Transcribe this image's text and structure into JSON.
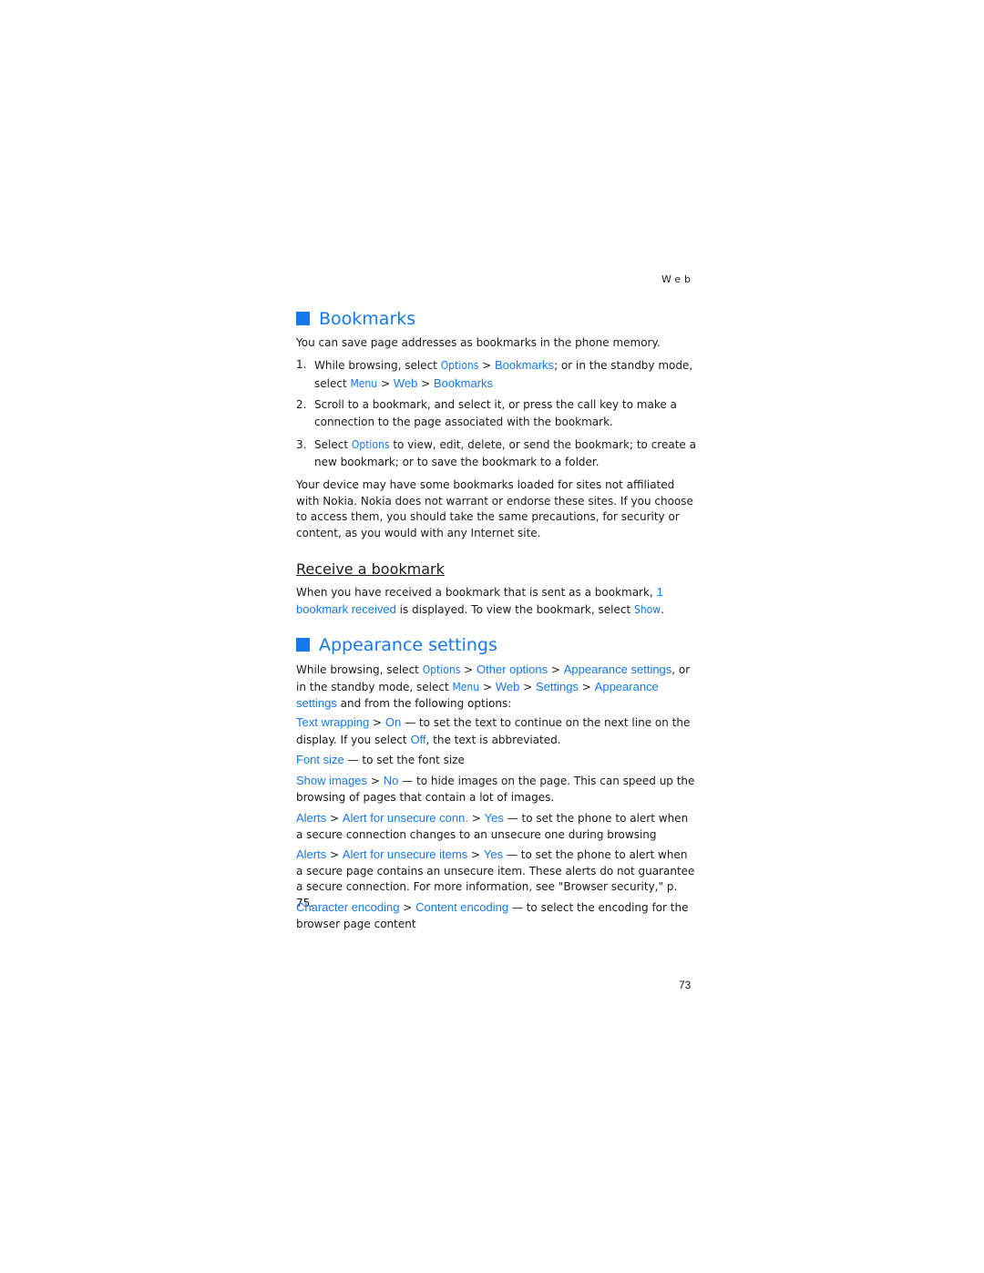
{
  "running_head": "Web",
  "page_number": "73",
  "sections": {
    "bookmarks": {
      "title": "Bookmarks",
      "intro": "You can save page addresses as bookmarks in the phone memory.",
      "steps": [
        {
          "num": "1.",
          "t1": "While browsing, select ",
          "ui1": "Options",
          "t2": " > ",
          "ui2": "Bookmarks",
          "t3": "; or in the standby mode, select ",
          "ui3": "Menu",
          "t4": " > ",
          "ui4": "Web",
          "t5": " > ",
          "ui5": "Bookmarks"
        },
        {
          "num": "2.",
          "text": "Scroll to a bookmark, and select it, or press the call key to make a connection to the page associated with the bookmark."
        },
        {
          "num": "3.",
          "t1": "Select ",
          "ui1": "Options",
          "t2": " to view, edit, delete, or send the bookmark; to create a new bookmark; or to save the bookmark to a folder."
        }
      ],
      "disclaimer": "Your device may have some bookmarks loaded for sites not affiliated with Nokia. Nokia does not warrant or endorse these sites. If you choose to access them, you should take the same precautions, for security or content, as you would with any Internet site."
    },
    "receive": {
      "title": "Receive a bookmark",
      "t1": "When you have received a bookmark that is sent as a bookmark, ",
      "ui1": "1 bookmark received",
      "t2": " is displayed. To view the bookmark, select ",
      "ui2": "Show",
      "t3": "."
    },
    "appearance": {
      "title": "Appearance settings",
      "intro": {
        "t1": "While browsing, select ",
        "ui1": "Options",
        "t2": " > ",
        "ui2": "Other options",
        "t3": " > ",
        "ui3": "Appearance settings",
        "t4": ", or in the standby mode, select ",
        "ui4": "Menu",
        "t5": " > ",
        "ui5": "Web",
        "t6": " > ",
        "ui6": "Settings",
        "t7": " > ",
        "ui7": "Appearance settings",
        "t8": " and from the following options:"
      },
      "options": [
        {
          "ui1": "Text wrapping",
          "sep": " > ",
          "ui2": "On",
          "text": " — to set the text to continue on the next line on the display. If you select ",
          "ui3": "Off",
          "text2": ", the text is abbreviated."
        },
        {
          "ui1": "Font size",
          "text": " — to set the font size"
        },
        {
          "ui1": "Show images",
          "sep": " > ",
          "ui2": "No",
          "text": " — to hide images on the page. This can speed up the browsing of pages that contain a lot of images."
        },
        {
          "ui1": "Alerts",
          "sep1": " > ",
          "ui2": "Alert for unsecure conn.",
          "sep2": " > ",
          "ui3": "Yes",
          "text": " — to set the phone to alert when a secure connection changes to an unsecure one during browsing"
        },
        {
          "ui1": "Alerts",
          "sep1": " > ",
          "ui2": "Alert for unsecure items",
          "sep2": " > ",
          "ui3": "Yes",
          "text": " — to set the phone to alert when a secure page contains an unsecure item. These alerts do not guarantee a secure connection. For more information, see \"Browser security,\" p. 75."
        },
        {
          "ui1": "Character encoding",
          "sep": " > ",
          "ui2": "Content encoding",
          "text": " — to select the encoding for the browser page content"
        }
      ]
    }
  }
}
